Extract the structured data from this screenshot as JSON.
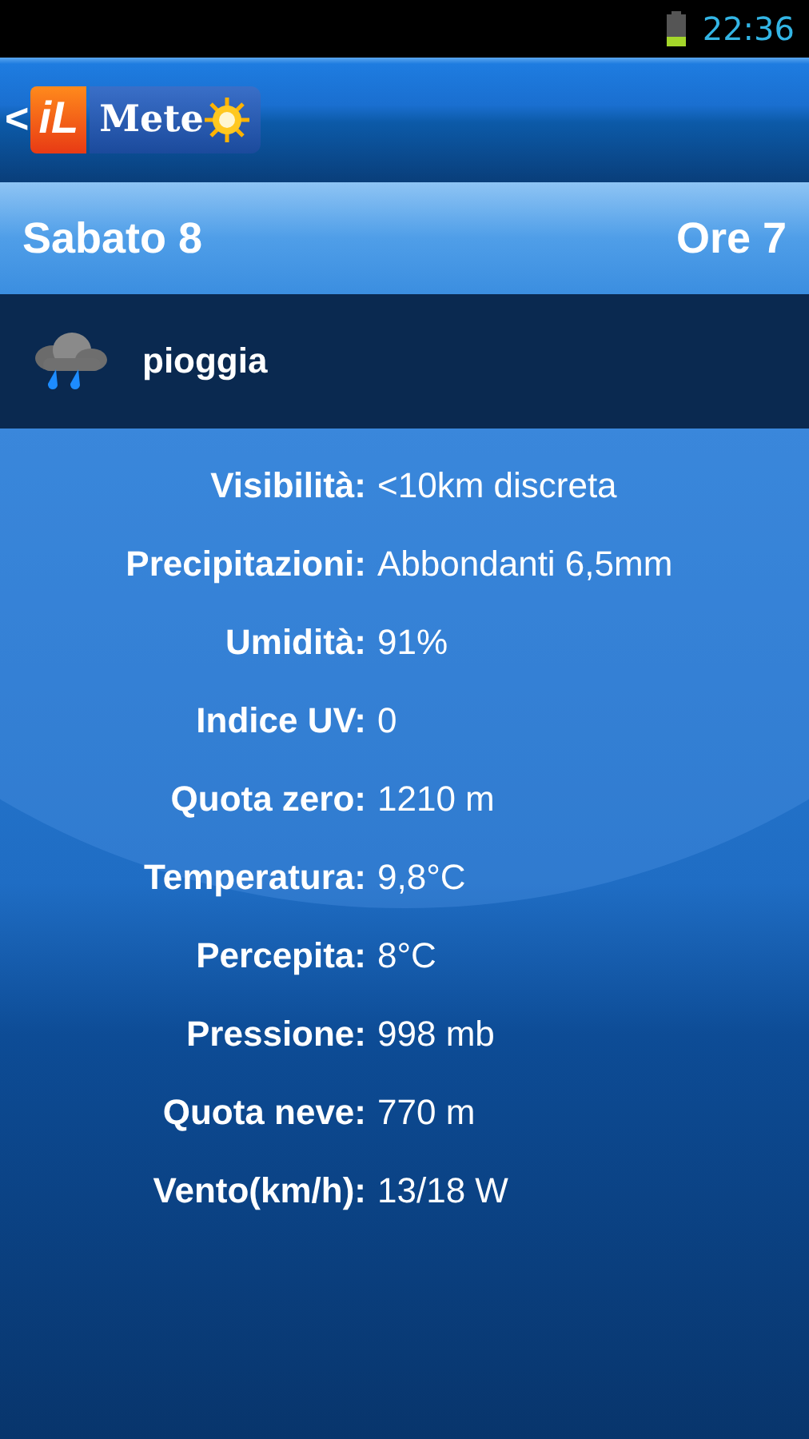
{
  "status_bar": {
    "time": "22:36"
  },
  "header": {
    "back": "<",
    "logo_left": "iL",
    "logo_right": "Mete"
  },
  "date_bar": {
    "day": "Sabato 8",
    "hour": "Ore 7"
  },
  "condition": {
    "label": "pioggia"
  },
  "details": [
    {
      "label": "Visibilità:",
      "value": "<10km discreta"
    },
    {
      "label": "Precipitazioni:",
      "value": "Abbondanti 6,5mm"
    },
    {
      "label": "Umidità:",
      "value": "91%"
    },
    {
      "label": "Indice UV:",
      "value": "0"
    },
    {
      "label": "Quota zero:",
      "value": "1210 m"
    },
    {
      "label": "Temperatura:",
      "value": "9,8°C"
    },
    {
      "label": "Percepita:",
      "value": "8°C"
    },
    {
      "label": "Pressione:",
      "value": "998 mb"
    },
    {
      "label": "Quota neve:",
      "value": "770 m"
    },
    {
      "label": "Vento(km/h):",
      "value": "13/18 W"
    }
  ]
}
